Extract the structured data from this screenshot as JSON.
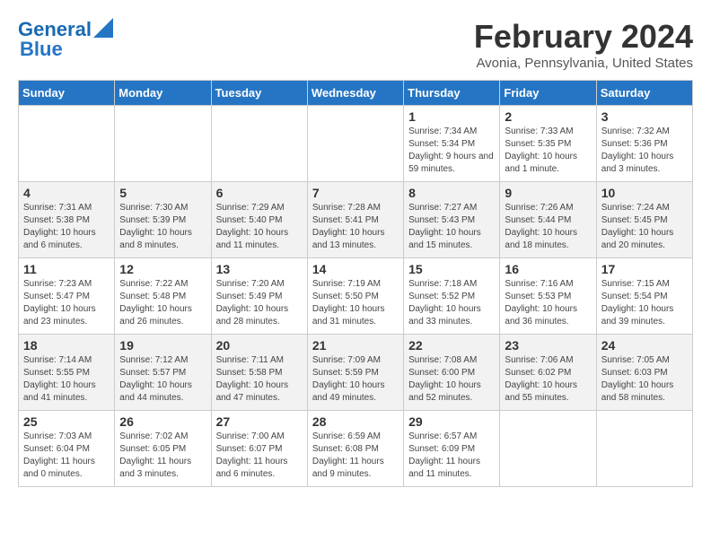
{
  "header": {
    "logo_line1": "General",
    "logo_line2": "Blue",
    "title": "February 2024",
    "subtitle": "Avonia, Pennsylvania, United States"
  },
  "days_of_week": [
    "Sunday",
    "Monday",
    "Tuesday",
    "Wednesday",
    "Thursday",
    "Friday",
    "Saturday"
  ],
  "weeks": [
    [
      {
        "day": "",
        "info": ""
      },
      {
        "day": "",
        "info": ""
      },
      {
        "day": "",
        "info": ""
      },
      {
        "day": "",
        "info": ""
      },
      {
        "day": "1",
        "info": "Sunrise: 7:34 AM\nSunset: 5:34 PM\nDaylight: 9 hours and 59 minutes."
      },
      {
        "day": "2",
        "info": "Sunrise: 7:33 AM\nSunset: 5:35 PM\nDaylight: 10 hours and 1 minute."
      },
      {
        "day": "3",
        "info": "Sunrise: 7:32 AM\nSunset: 5:36 PM\nDaylight: 10 hours and 3 minutes."
      }
    ],
    [
      {
        "day": "4",
        "info": "Sunrise: 7:31 AM\nSunset: 5:38 PM\nDaylight: 10 hours and 6 minutes."
      },
      {
        "day": "5",
        "info": "Sunrise: 7:30 AM\nSunset: 5:39 PM\nDaylight: 10 hours and 8 minutes."
      },
      {
        "day": "6",
        "info": "Sunrise: 7:29 AM\nSunset: 5:40 PM\nDaylight: 10 hours and 11 minutes."
      },
      {
        "day": "7",
        "info": "Sunrise: 7:28 AM\nSunset: 5:41 PM\nDaylight: 10 hours and 13 minutes."
      },
      {
        "day": "8",
        "info": "Sunrise: 7:27 AM\nSunset: 5:43 PM\nDaylight: 10 hours and 15 minutes."
      },
      {
        "day": "9",
        "info": "Sunrise: 7:26 AM\nSunset: 5:44 PM\nDaylight: 10 hours and 18 minutes."
      },
      {
        "day": "10",
        "info": "Sunrise: 7:24 AM\nSunset: 5:45 PM\nDaylight: 10 hours and 20 minutes."
      }
    ],
    [
      {
        "day": "11",
        "info": "Sunrise: 7:23 AM\nSunset: 5:47 PM\nDaylight: 10 hours and 23 minutes."
      },
      {
        "day": "12",
        "info": "Sunrise: 7:22 AM\nSunset: 5:48 PM\nDaylight: 10 hours and 26 minutes."
      },
      {
        "day": "13",
        "info": "Sunrise: 7:20 AM\nSunset: 5:49 PM\nDaylight: 10 hours and 28 minutes."
      },
      {
        "day": "14",
        "info": "Sunrise: 7:19 AM\nSunset: 5:50 PM\nDaylight: 10 hours and 31 minutes."
      },
      {
        "day": "15",
        "info": "Sunrise: 7:18 AM\nSunset: 5:52 PM\nDaylight: 10 hours and 33 minutes."
      },
      {
        "day": "16",
        "info": "Sunrise: 7:16 AM\nSunset: 5:53 PM\nDaylight: 10 hours and 36 minutes."
      },
      {
        "day": "17",
        "info": "Sunrise: 7:15 AM\nSunset: 5:54 PM\nDaylight: 10 hours and 39 minutes."
      }
    ],
    [
      {
        "day": "18",
        "info": "Sunrise: 7:14 AM\nSunset: 5:55 PM\nDaylight: 10 hours and 41 minutes."
      },
      {
        "day": "19",
        "info": "Sunrise: 7:12 AM\nSunset: 5:57 PM\nDaylight: 10 hours and 44 minutes."
      },
      {
        "day": "20",
        "info": "Sunrise: 7:11 AM\nSunset: 5:58 PM\nDaylight: 10 hours and 47 minutes."
      },
      {
        "day": "21",
        "info": "Sunrise: 7:09 AM\nSunset: 5:59 PM\nDaylight: 10 hours and 49 minutes."
      },
      {
        "day": "22",
        "info": "Sunrise: 7:08 AM\nSunset: 6:00 PM\nDaylight: 10 hours and 52 minutes."
      },
      {
        "day": "23",
        "info": "Sunrise: 7:06 AM\nSunset: 6:02 PM\nDaylight: 10 hours and 55 minutes."
      },
      {
        "day": "24",
        "info": "Sunrise: 7:05 AM\nSunset: 6:03 PM\nDaylight: 10 hours and 58 minutes."
      }
    ],
    [
      {
        "day": "25",
        "info": "Sunrise: 7:03 AM\nSunset: 6:04 PM\nDaylight: 11 hours and 0 minutes."
      },
      {
        "day": "26",
        "info": "Sunrise: 7:02 AM\nSunset: 6:05 PM\nDaylight: 11 hours and 3 minutes."
      },
      {
        "day": "27",
        "info": "Sunrise: 7:00 AM\nSunset: 6:07 PM\nDaylight: 11 hours and 6 minutes."
      },
      {
        "day": "28",
        "info": "Sunrise: 6:59 AM\nSunset: 6:08 PM\nDaylight: 11 hours and 9 minutes."
      },
      {
        "day": "29",
        "info": "Sunrise: 6:57 AM\nSunset: 6:09 PM\nDaylight: 11 hours and 11 minutes."
      },
      {
        "day": "",
        "info": ""
      },
      {
        "day": "",
        "info": ""
      }
    ]
  ]
}
